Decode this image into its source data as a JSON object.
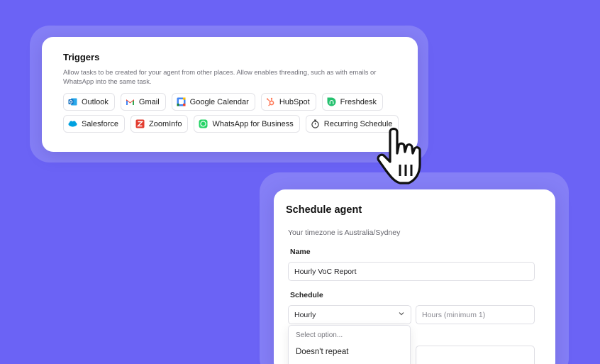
{
  "triggers": {
    "title": "Triggers",
    "description": "Allow tasks to be created for your agent from other places. Allow enables threading, such as with emails or WhatsApp into the same task.",
    "row1": [
      {
        "label": "Outlook",
        "icon": "outlook-icon",
        "color": "#0f6cbd"
      },
      {
        "label": "Gmail",
        "icon": "gmail-icon",
        "color": "#ea4335"
      },
      {
        "label": "Google Calendar",
        "icon": "google-calendar-icon",
        "color": "#4285f4"
      },
      {
        "label": "HubSpot",
        "icon": "hubspot-icon",
        "color": "#ff7a59"
      },
      {
        "label": "Freshdesk",
        "icon": "freshdesk-icon",
        "color": "#25c16f"
      }
    ],
    "row2": [
      {
        "label": "Salesforce",
        "icon": "salesforce-icon",
        "color": "#00a1e0"
      },
      {
        "label": "ZoomInfo",
        "icon": "zoominfo-icon",
        "color": "#e23b2e"
      },
      {
        "label": "WhatsApp for Business",
        "icon": "whatsapp-icon",
        "color": "#25d366"
      },
      {
        "label": "Recurring Schedule",
        "icon": "stopwatch-icon",
        "color": "#333333"
      }
    ]
  },
  "schedule": {
    "title": "Schedule agent",
    "timezone_text": "Your timezone is Australia/Sydney",
    "name_label": "Name",
    "name_value": "Hourly VoC Report",
    "schedule_label": "Schedule",
    "frequency_value": "Hourly",
    "hours_placeholder": "Hours (minimum 1)",
    "dropdown_placeholder": "Select option...",
    "dropdown_options": [
      "Doesn't repeat"
    ]
  },
  "colors": {
    "background": "#6b63f5",
    "card": "#ffffff"
  }
}
